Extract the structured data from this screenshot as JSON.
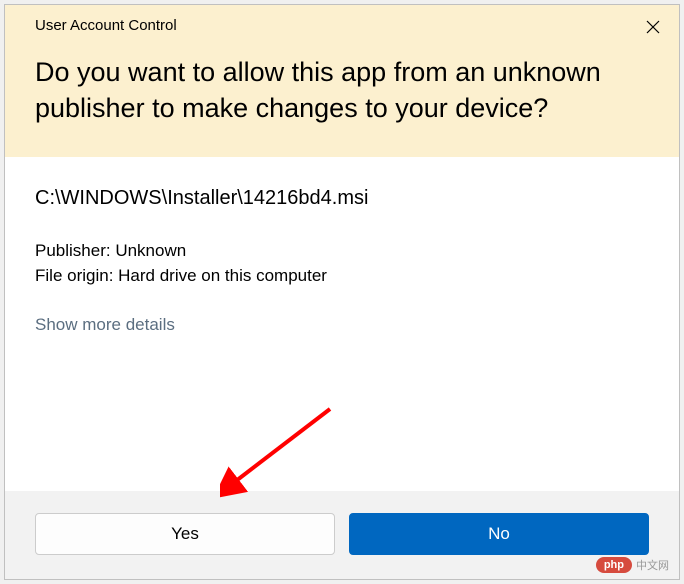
{
  "dialog": {
    "title": "User Account Control",
    "heading": "Do you want to allow this app from an unknown publisher to make changes to your device?",
    "filepath": "C:\\WINDOWS\\Installer\\14216bd4.msi",
    "publisher_line": "Publisher: Unknown",
    "origin_line": "File origin: Hard drive on this computer",
    "details_link": "Show more details",
    "buttons": {
      "yes": "Yes",
      "no": "No"
    }
  },
  "watermark": {
    "pill": "php",
    "text": "中文网"
  }
}
